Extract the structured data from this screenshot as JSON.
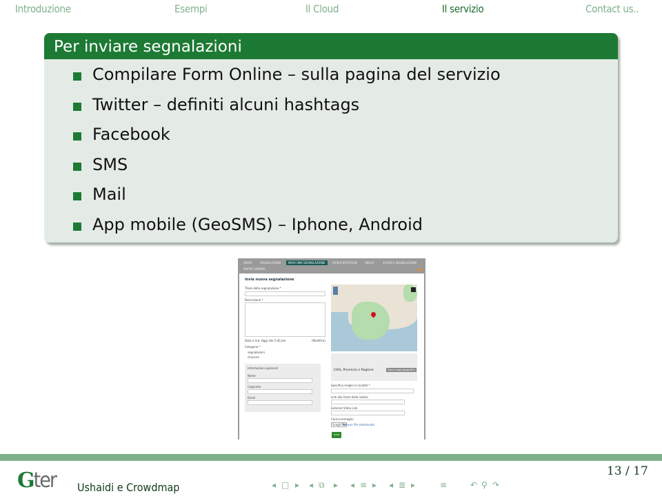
{
  "topnav": {
    "items": [
      {
        "label": "Introduzione"
      },
      {
        "label": "Esempi"
      },
      {
        "label": "Il Cloud"
      },
      {
        "label": "Il servizio",
        "active": true
      },
      {
        "label": "Contact us.."
      }
    ]
  },
  "block": {
    "title": "Per inviare segnalazioni",
    "items": [
      "Compilare Form Online – sulla pagina del servizio",
      "Twitter – definiti alcuni hashtags",
      "Facebook",
      "SMS",
      "Mail",
      "App mobile (GeoSMS) – Iphone, Android"
    ]
  },
  "embedded_screenshot": {
    "nav": [
      "HOME",
      "SEGNALAZIONI",
      "INVIA UNA SEGNALAZIONE",
      "RICEVI NOTIFICHE",
      "ABOUT",
      "SCARICA SEGNALAZIONI",
      "MAPPA GRANDE"
    ],
    "active_nav": "INVIA UNA SEGNALAZIONE",
    "form_title": "Invia nuova segnalazione",
    "fields": {
      "title_label": "Titolo della segnalazione *",
      "description_label": "Descrizione *",
      "date_label": "Data e ora: Oggi alle 5:40 pm",
      "date_modify": "(Modifica)",
      "category_label": "Categorie *",
      "category_1": "segnalazioni",
      "category_2": "chiusure",
      "optional_info": "Informazioni opzionali",
      "name_label": "Nome",
      "surname_label": "Cognome",
      "email_label": "Email",
      "location_label": "Città, Provincia o Regione",
      "location_button": "Trova luogo geografico",
      "specify_location": "Specifica meglio la località *",
      "news_link": "Link alla fonte della notizia",
      "video_link": "External Video Link",
      "upload_label": "Carica immagini",
      "upload_button": "Scegli file",
      "upload_status": "Nessun file selezionato",
      "submit": "Invia"
    }
  },
  "footer": {
    "logo_g": "G",
    "logo_rest": "ter",
    "title": "Ushaidi e Crowdmap",
    "page": "13 / 17",
    "nav_icons": [
      "prev-frame",
      "frame-icon",
      "next-frame",
      "prev-subsection",
      "subsection-icon",
      "next-subsection",
      "prev-section",
      "section-icon",
      "next-section",
      "prev-doc",
      "doc-icon",
      "next-doc",
      "toc-icon",
      "back-icon",
      "search-icon",
      "forward-icon"
    ],
    "nav_glyphs": {
      "left": "◂",
      "right": "▸",
      "frame": "□",
      "subsection": "⧉",
      "section": "≡",
      "doc": "≣",
      "toc": "≡",
      "back": "↶",
      "search": "⚲",
      "forward": "↷"
    }
  }
}
